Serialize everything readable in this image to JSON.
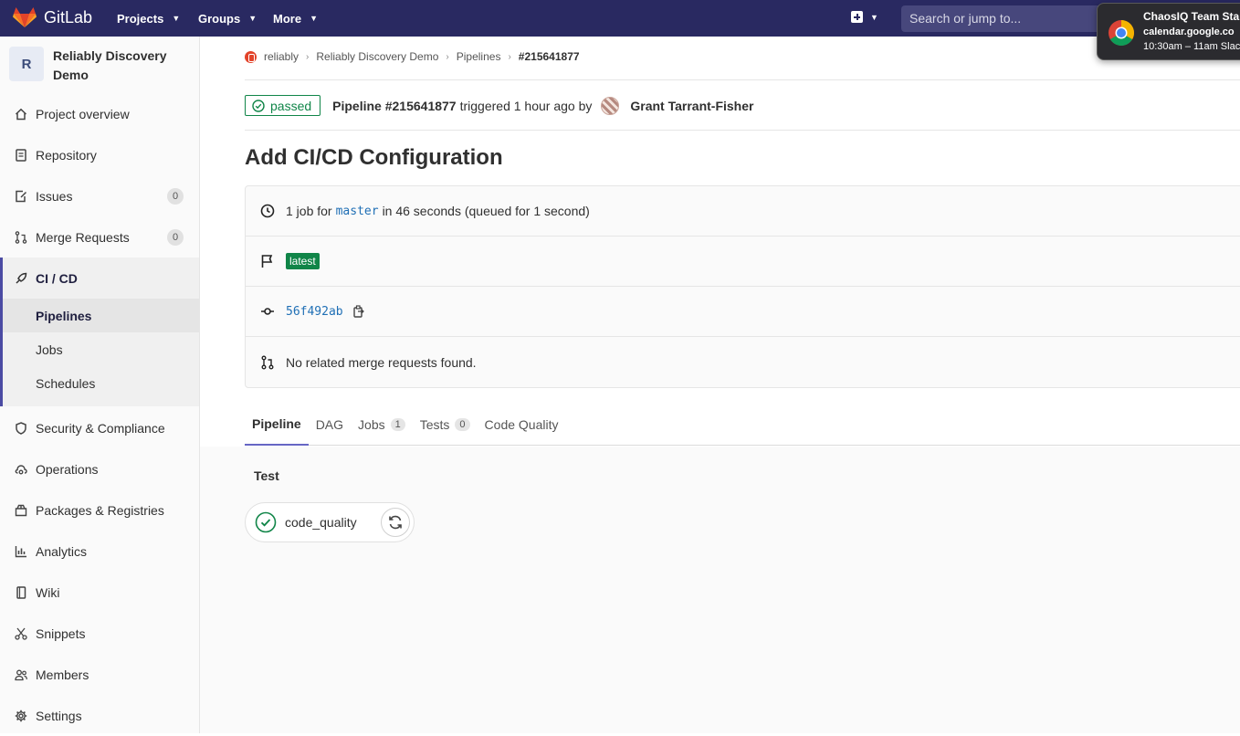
{
  "topbar": {
    "brand": "GitLab",
    "nav": [
      {
        "label": "Projects"
      },
      {
        "label": "Groups"
      },
      {
        "label": "More"
      }
    ],
    "search_placeholder": "Search or jump to...",
    "accent": "#292961"
  },
  "notification": {
    "title": "ChaosIQ Team Sta",
    "source": "calendar.google.co",
    "time": "10:30am – 11am Slac"
  },
  "sidebar": {
    "project_avatar": "R",
    "project_name": "Reliably Discovery Demo",
    "items": [
      {
        "label": "Project overview",
        "icon": "home-icon"
      },
      {
        "label": "Repository",
        "icon": "doc-icon"
      },
      {
        "label": "Issues",
        "icon": "issues-icon",
        "count": "0"
      },
      {
        "label": "Merge Requests",
        "icon": "merge-request-icon",
        "count": "0"
      },
      {
        "label": "CI / CD",
        "icon": "rocket-icon"
      },
      {
        "label": "Security & Compliance",
        "icon": "shield-icon"
      },
      {
        "label": "Operations",
        "icon": "cloud-gear-icon"
      },
      {
        "label": "Packages & Registries",
        "icon": "package-icon"
      },
      {
        "label": "Analytics",
        "icon": "chart-icon"
      },
      {
        "label": "Wiki",
        "icon": "book-icon"
      },
      {
        "label": "Snippets",
        "icon": "scissors-icon"
      },
      {
        "label": "Members",
        "icon": "users-icon"
      },
      {
        "label": "Settings",
        "icon": "gear-icon"
      }
    ],
    "cicd_sub": [
      {
        "label": "Pipelines"
      },
      {
        "label": "Jobs"
      },
      {
        "label": "Schedules"
      }
    ]
  },
  "breadcrumb": [
    "reliably",
    "Reliably Discovery Demo",
    "Pipelines",
    "#215641877"
  ],
  "pipeline": {
    "status": "passed",
    "title": "Pipeline #215641877",
    "triggered": "triggered 1 hour ago by",
    "author": "Grant Tarrant-Fisher",
    "commit_title": "Add CI/CD Configuration",
    "status_color": "#108548"
  },
  "info": {
    "jobs_prefix": "1 job for",
    "branch": "master",
    "jobs_suffix": "in 46 seconds (queued for 1 second)",
    "tag": "latest",
    "sha": "56f492ab",
    "mr_text": "No related merge requests found."
  },
  "tabs": [
    {
      "label": "Pipeline"
    },
    {
      "label": "DAG"
    },
    {
      "label": "Jobs",
      "count": "1"
    },
    {
      "label": "Tests",
      "count": "0"
    },
    {
      "label": "Code Quality"
    }
  ],
  "graph": {
    "stage": "Test",
    "job": "code_quality"
  }
}
